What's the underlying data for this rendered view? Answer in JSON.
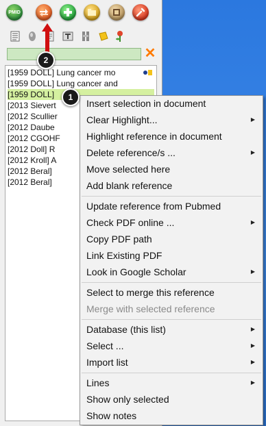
{
  "toolbar": {
    "pmid_label": "PMID",
    "round_buttons": [
      {
        "name": "pmid-icon",
        "color": "#2d8f3c"
      },
      {
        "name": "reorder-icon",
        "color": "#e8672a"
      },
      {
        "name": "add-icon",
        "color": "#36b34a"
      },
      {
        "name": "folder-icon",
        "color": "#d9a419"
      },
      {
        "name": "settings-icon",
        "color": "#c9a56a"
      },
      {
        "name": "tools-icon",
        "color": "#e0462e"
      }
    ],
    "small_tools": [
      "list-icon",
      "tag-icon",
      "attach-icon",
      "pin-icon",
      "bookmark-icon",
      "note-icon",
      "flower-icon"
    ]
  },
  "search": {
    "value": ""
  },
  "references": [
    {
      "text": "[1959  DOLL]  Lung cancer mo",
      "selected": false
    },
    {
      "text": "[1959 DOLL] Lung cancer and",
      "selected": false
    },
    {
      "text": "[1959  DOLL]",
      "selected": true
    },
    {
      "text": "[2013 Sievert",
      "selected": false
    },
    {
      "text": "[2012 Scullier",
      "selected": false
    },
    {
      "text": "[2012 Daube",
      "selected": false
    },
    {
      "text": "[2012 CGOHF",
      "selected": false
    },
    {
      "text": "[2012  Doll]  R",
      "selected": false
    },
    {
      "text": "[2012 Kroll] A",
      "selected": false
    },
    {
      "text": "[2012  Beral]",
      "selected": false
    },
    {
      "text": "[2012  Beral]",
      "selected": false
    }
  ],
  "context_menu": {
    "items": [
      {
        "label": "Insert selection in document",
        "submenu": false,
        "disabled": false
      },
      {
        "label": "Clear Highlight...",
        "submenu": true,
        "disabled": false
      },
      {
        "label": "Highlight reference in document",
        "submenu": false,
        "disabled": false
      },
      {
        "label": "Delete reference/s ...",
        "submenu": true,
        "disabled": false
      },
      {
        "label": "Move selected here",
        "submenu": false,
        "disabled": false
      },
      {
        "label": "Add blank reference",
        "submenu": false,
        "disabled": false
      },
      {
        "label": "Update reference from Pubmed",
        "submenu": false,
        "disabled": false
      },
      {
        "label": "Check PDF online ...",
        "submenu": true,
        "disabled": false
      },
      {
        "label": "Copy PDF path",
        "submenu": false,
        "disabled": false
      },
      {
        "label": "Link Existing PDF",
        "submenu": false,
        "disabled": false
      },
      {
        "label": "Look in Google Scholar",
        "submenu": true,
        "disabled": false
      },
      {
        "label": "Select to merge this reference",
        "submenu": false,
        "disabled": false
      },
      {
        "label": "Merge with selected reference",
        "submenu": false,
        "disabled": true
      },
      {
        "label": "Database (this list)",
        "submenu": true,
        "disabled": false
      },
      {
        "label": "Select ...",
        "submenu": true,
        "disabled": false
      },
      {
        "label": "Import list",
        "submenu": true,
        "disabled": false
      },
      {
        "label": "Lines",
        "submenu": true,
        "disabled": false
      },
      {
        "label": "Show only selected",
        "submenu": false,
        "disabled": false
      },
      {
        "label": "Show notes",
        "submenu": false,
        "disabled": false
      }
    ]
  },
  "callouts": [
    {
      "number": "1"
    },
    {
      "number": "2"
    }
  ],
  "colors": {
    "desktop": "#2f7fe3",
    "selected_row": "#d5f0a0",
    "search_bg": "#cde8c2",
    "callout_arrow": "#d01010"
  }
}
